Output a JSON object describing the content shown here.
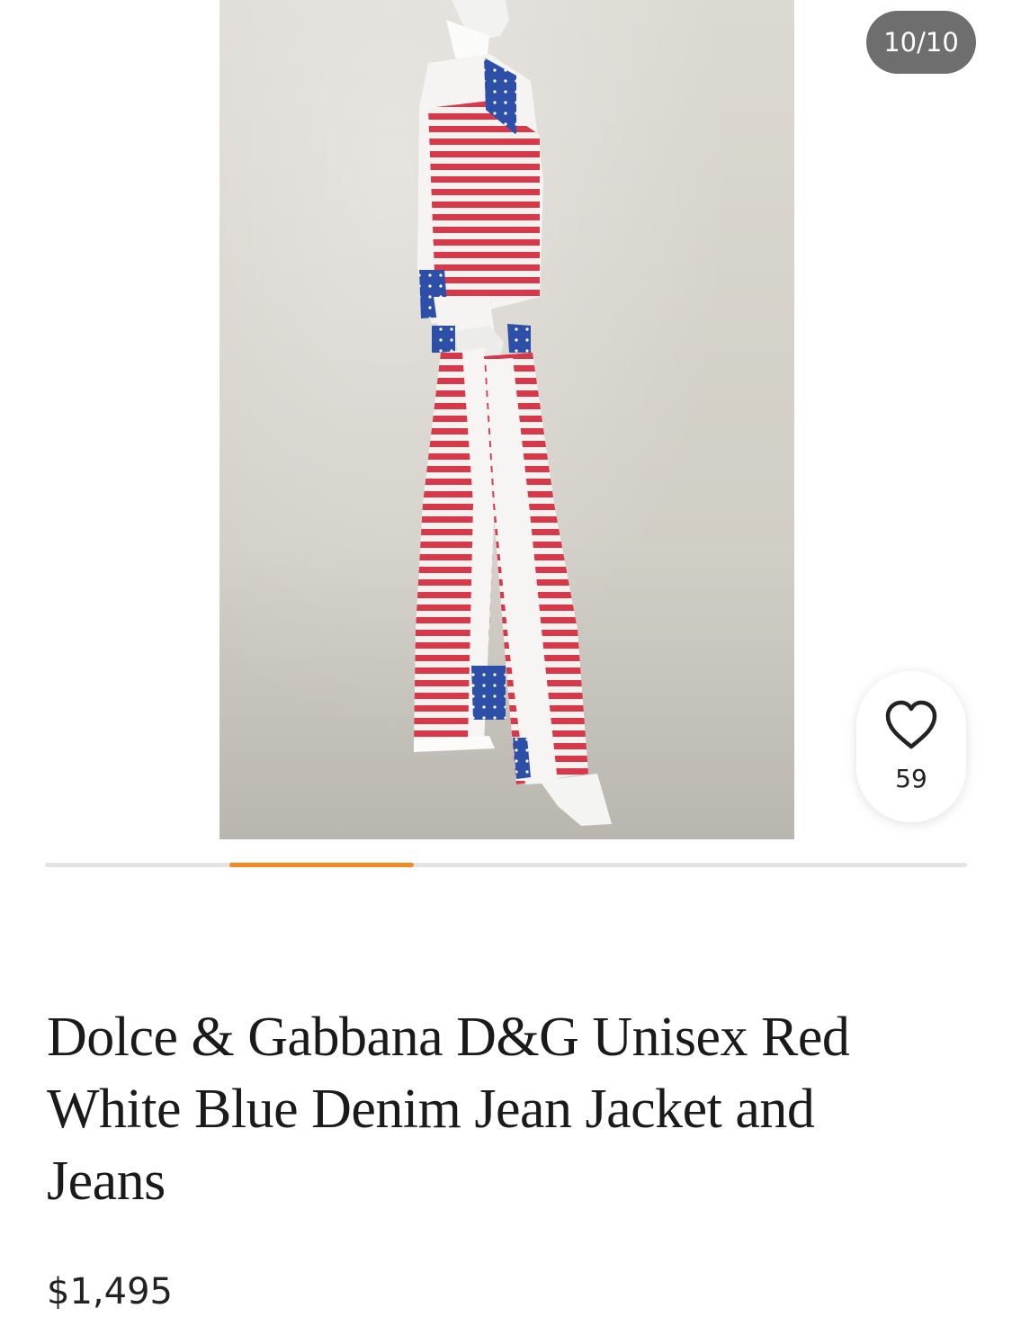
{
  "gallery": {
    "counter": "10/10",
    "image_alt": "Mannequin wearing a red, white and blue flag-print denim jacket and jeans",
    "favorite_icon": "heart-icon",
    "favorite_count": "59",
    "slides_total": 10,
    "active_slide": 10,
    "indicator_color": "#f08a24"
  },
  "product": {
    "title": "Dolce & Gabbana D&G Unisex Red White Blue Denim Jean Jacket and Jeans",
    "price": "$1,495"
  },
  "colors": {
    "accent": "#f08a24",
    "pill": "#6e6e6e",
    "text": "#1a1a1a"
  }
}
